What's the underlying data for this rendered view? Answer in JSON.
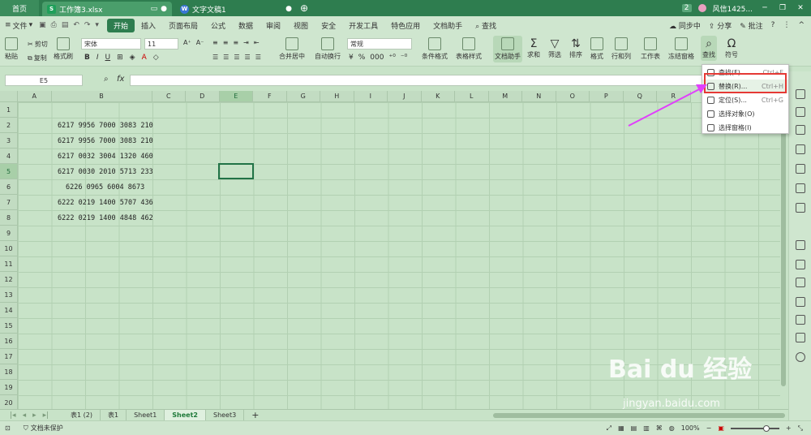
{
  "titlebar": {
    "home_tab": "首页",
    "doc_tab": "工作簿3.xlsx",
    "other_tab": "文字文稿1",
    "badge": "2",
    "user": "风信1425..."
  },
  "menubar": {
    "file": "文件",
    "items": [
      "开始",
      "插入",
      "页面布局",
      "公式",
      "数据",
      "审阅",
      "视图",
      "安全",
      "开发工具",
      "特色应用",
      "文档助手"
    ],
    "search": "查找",
    "sync": "同步中",
    "share": "分享",
    "comment": "批注"
  },
  "ribbon": {
    "paste": "粘贴",
    "cut": "剪切",
    "copy": "复制",
    "format_painter": "格式刷",
    "font_name": "宋体",
    "font_size": "11",
    "number_format": "常规",
    "merge": "合并居中",
    "wrap": "自动换行",
    "cond_format": "条件格式",
    "table_style": "表格样式",
    "doc_helper": "文档助手",
    "sum": "求和",
    "filter": "筛选",
    "sort": "排序",
    "format": "格式",
    "rowcol": "行和列",
    "worksheet": "工作表",
    "freeze": "冻结窗格",
    "find": "查找",
    "symbol": "符号"
  },
  "formula": {
    "cell_ref": "E5",
    "fx": "fx"
  },
  "grid": {
    "columns": [
      "A",
      "B",
      "C",
      "D",
      "E",
      "F",
      "G",
      "H",
      "I",
      "J",
      "K",
      "L",
      "M",
      "N",
      "O",
      "P",
      "Q",
      "R"
    ],
    "rows": [
      "1",
      "2",
      "3",
      "4",
      "5",
      "6",
      "7",
      "8",
      "9",
      "10",
      "11",
      "12",
      "13",
      "14",
      "15",
      "16",
      "17",
      "18",
      "19",
      "20"
    ],
    "cells": [
      "6217 9956 7000 3083 210",
      "6217 9956 7000 3083 210",
      "6217 0032 3004 1320 460",
      "6217 0030 2010 5713 233",
      "6226 0965 6004 8673",
      "6222 0219 1400 5707 436",
      "6222 0219 1400 4848 462"
    ]
  },
  "dropdown": {
    "items": [
      {
        "label": "查找(F)...",
        "shortcut": "Ctrl+F"
      },
      {
        "label": "替换(R)...",
        "shortcut": "Ctrl+H"
      },
      {
        "label": "定位(S)...",
        "shortcut": "Ctrl+G"
      },
      {
        "label": "选择对象(O)",
        "shortcut": ""
      },
      {
        "label": "选择窗格(I)",
        "shortcut": ""
      }
    ]
  },
  "sheets": {
    "tabs": [
      "表1 (2)",
      "表1",
      "Sheet1",
      "Sheet2",
      "Sheet3"
    ],
    "active": "Sheet2",
    "add": "+"
  },
  "status": {
    "protect": "文档未保护",
    "zoom": "100%"
  },
  "watermark": {
    "brand": "Bai du 经验",
    "url": "jingyan.baidu.com"
  },
  "colors": {
    "accent": "#2e7d4f",
    "highlight": "#e53935",
    "arrow": "#e040fb"
  }
}
